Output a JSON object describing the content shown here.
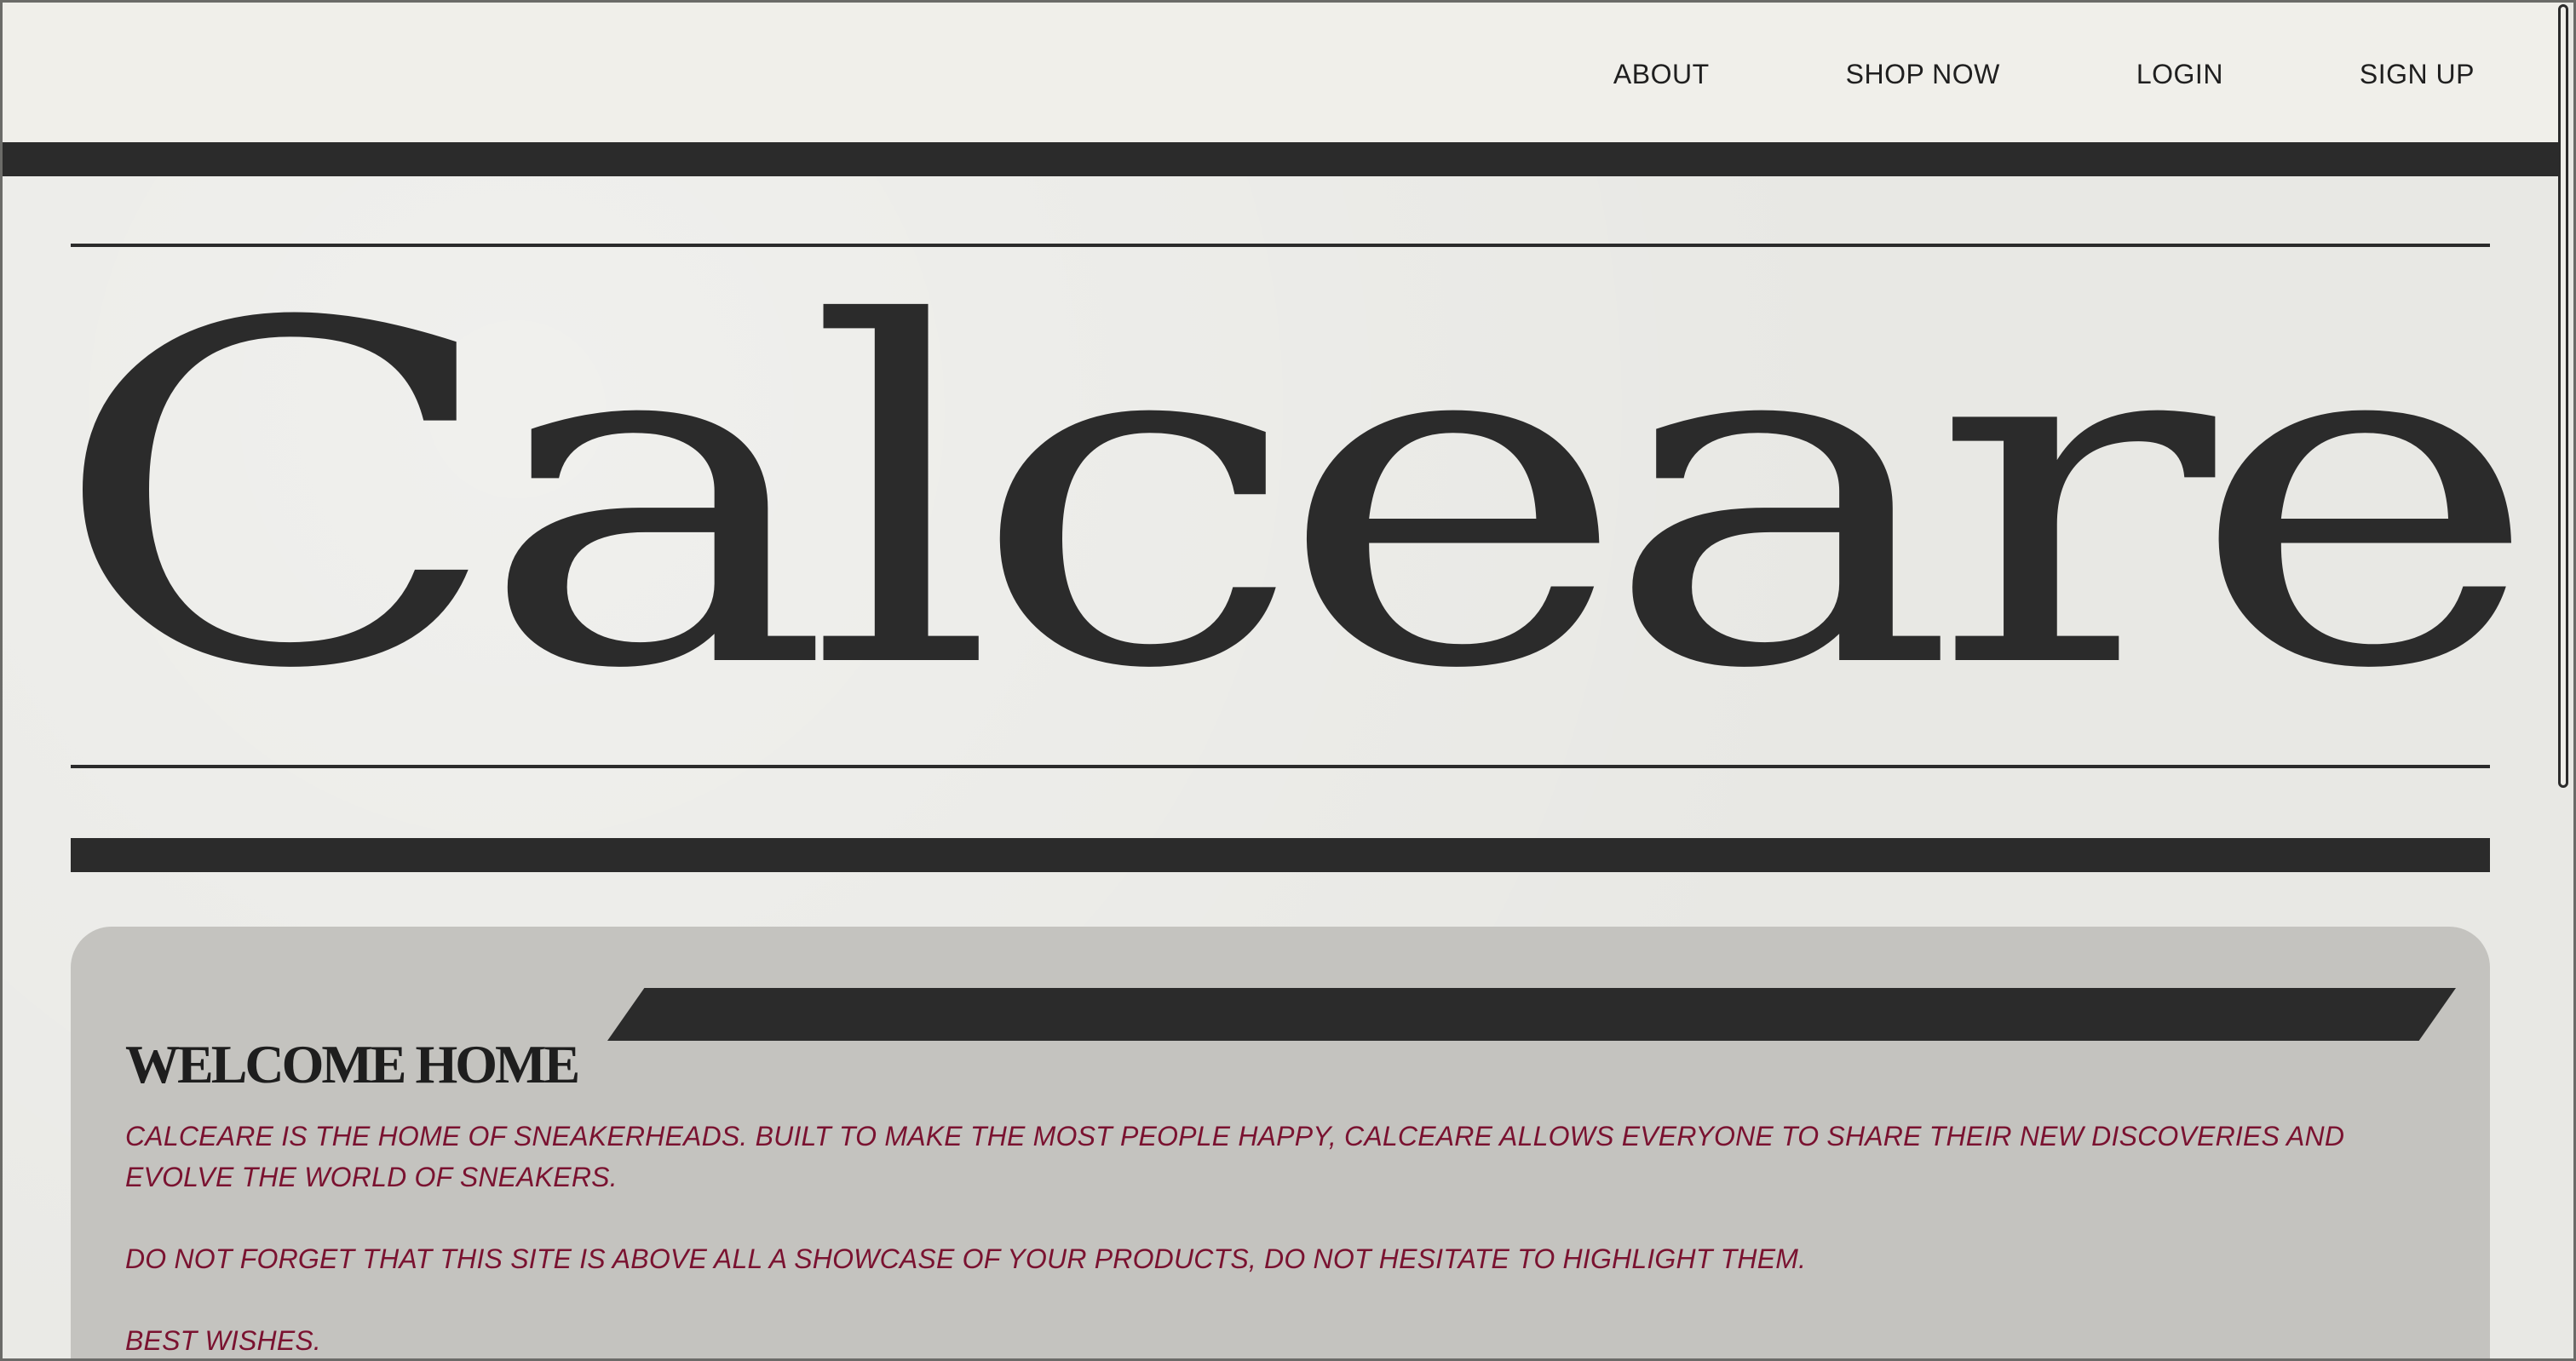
{
  "nav": {
    "items": [
      "ABOUT",
      "SHOP NOW",
      "LOGIN",
      "SIGN UP"
    ]
  },
  "hero": {
    "brand": "Calceare"
  },
  "welcome": {
    "title": "WELCOME HOME",
    "paragraphs": [
      "CALCEARE IS THE HOME OF SNEAKERHEADS. BUILT TO MAKE THE MOST PEOPLE HAPPY, CALCEARE ALLOWS EVERYONE TO SHARE THEIR NEW DISCOVERIES AND EVOLVE THE WORLD OF SNEAKERS.",
      "DO NOT FORGET THAT THIS SITE IS ABOVE ALL A SHOWCASE OF YOUR PRODUCTS, DO NOT HESITATE TO HIGHLIGHT THEM.",
      "BEST WISHES."
    ]
  },
  "colors": {
    "background": "#e8e8e4",
    "ink": "#2b2b2b",
    "panel": "#c4c3bf",
    "accent_text": "#7a1230"
  }
}
